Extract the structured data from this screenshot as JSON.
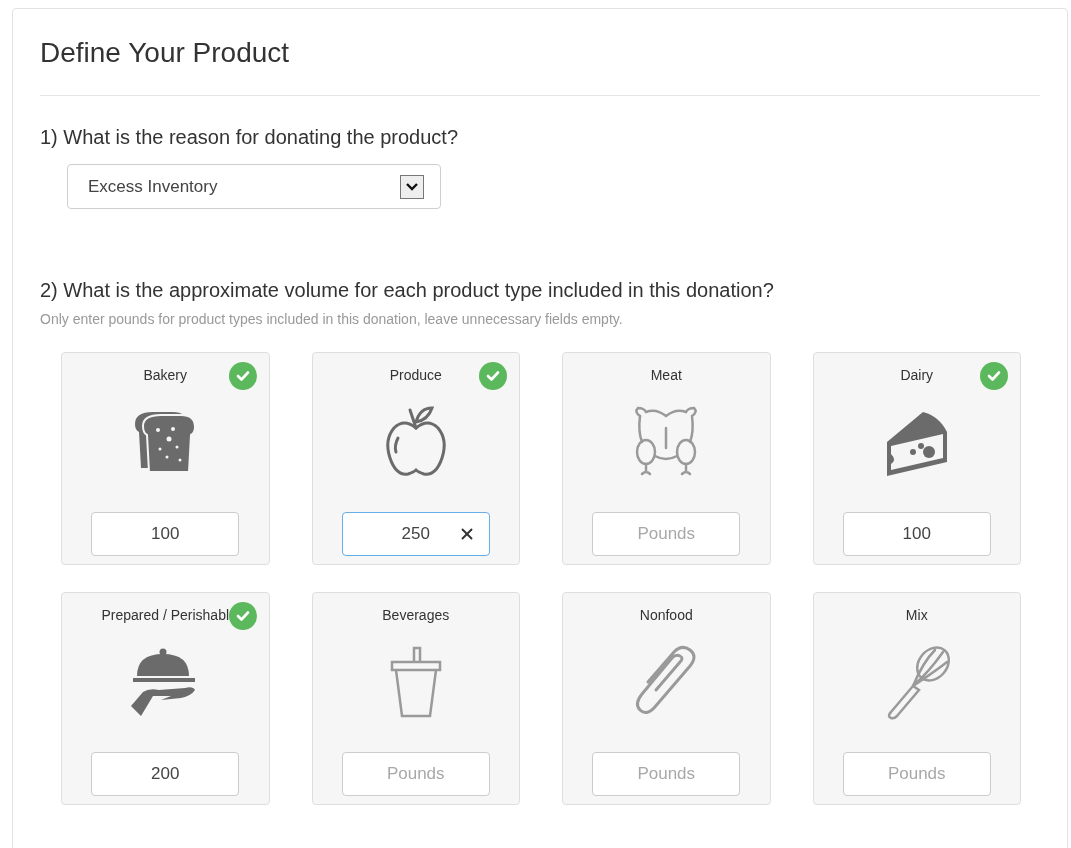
{
  "title": "Define Your Product",
  "question_1": {
    "label": "1) What is the reason for donating the product?",
    "select": {
      "value": "Excess Inventory"
    }
  },
  "question_2": {
    "label": "2) What is the approximate volume for each product type included in this donation?",
    "hint": "Only enter pounds for product types included in this donation, leave unnecessary fields empty.",
    "products": [
      {
        "label": "Bakery",
        "kind": "bread",
        "checked": true,
        "value": "100",
        "focused": false
      },
      {
        "label": "Produce",
        "kind": "apple",
        "checked": true,
        "value": "250",
        "focused": true
      },
      {
        "label": "Meat",
        "kind": "chicken",
        "checked": false,
        "placeholder": "Pounds",
        "focused": false
      },
      {
        "label": "Dairy",
        "kind": "cheese",
        "checked": true,
        "value": "100",
        "focused": false
      },
      {
        "label": "Prepared / Perishabl",
        "kind": "cloche",
        "checked": true,
        "value": "200",
        "focused": false
      },
      {
        "label": "Beverages",
        "kind": "cup",
        "checked": false,
        "placeholder": "Pounds",
        "focused": false
      },
      {
        "label": "Nonfood",
        "kind": "paperclip",
        "checked": false,
        "placeholder": "Pounds",
        "focused": false
      },
      {
        "label": "Mix",
        "kind": "whisk",
        "checked": false,
        "placeholder": "Pounds",
        "focused": false
      }
    ]
  }
}
